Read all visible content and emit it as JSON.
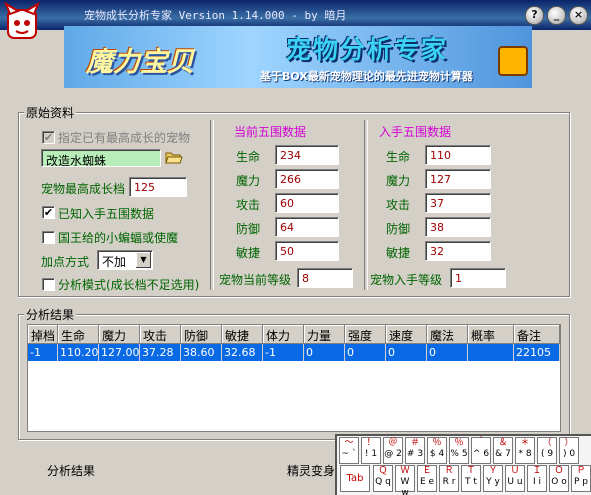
{
  "window": {
    "title": "宠物成长分析专家 Version 1.14.000 - by 暗月",
    "buttons": {
      "help": "?",
      "minimize": "_",
      "close": "×"
    }
  },
  "banner": {
    "logo_text": "魔力宝贝",
    "headline": "宠物分析专家",
    "subtitle": "基于BOX最新宠物理论的最先进宠物计算器"
  },
  "original": {
    "group_label": "原始资料",
    "designated_checkbox": {
      "label": "指定已有最高成长的宠物",
      "checked": true,
      "disabled": true
    },
    "pet_name": "改造水蜘蛛",
    "max_growth_label": "宠物最高成长档",
    "max_growth_value": "125",
    "known_stats_checkbox": {
      "label": "已知入手五围数据",
      "checked": true
    },
    "king_checkbox": {
      "label": "国王给的小蝙蝠或使魔",
      "checked": false
    },
    "add_method_label": "加点方式",
    "add_method_value": "不加",
    "analysis_mode_checkbox": {
      "label": "分析模式(成长档不足选用)",
      "checked": false
    },
    "current": {
      "title": "当前五围数据",
      "stats": [
        {
          "label": "生命",
          "value": "234"
        },
        {
          "label": "魔力",
          "value": "266"
        },
        {
          "label": "攻击",
          "value": "60"
        },
        {
          "label": "防御",
          "value": "64"
        },
        {
          "label": "敏捷",
          "value": "50"
        }
      ],
      "level_label": "宠物当前等级",
      "level_value": "8"
    },
    "acquired": {
      "title": "入手五围数据",
      "stats": [
        {
          "label": "生命",
          "value": "110"
        },
        {
          "label": "魔力",
          "value": "127"
        },
        {
          "label": "攻击",
          "value": "37"
        },
        {
          "label": "防御",
          "value": "38"
        },
        {
          "label": "敏捷",
          "value": "32"
        }
      ],
      "level_label": "宠物入手等级",
      "level_value": "1"
    }
  },
  "results": {
    "group_label": "分析结果",
    "columns": [
      "掉档",
      "生命",
      "魔力",
      "攻击",
      "防御",
      "敏捷",
      "体力",
      "力量",
      "强度",
      "速度",
      "魔法",
      "概率",
      "备注"
    ],
    "rows": [
      [
        "-1",
        "110.20",
        "127.00",
        "37.28",
        "38.60",
        "32.68",
        "-1",
        "0",
        "0",
        "0",
        "0",
        "",
        "22105"
      ]
    ]
  },
  "bottom": {
    "analyze_button": "分析结果",
    "spirit_label": "精灵变身"
  },
  "keyboard": {
    "row1": [
      {
        "top": "~",
        "bottom": "`",
        "alt": "～"
      },
      {
        "top": "!",
        "bottom": "1",
        "alt": "！"
      },
      {
        "top": "@",
        "bottom": "2",
        "alt": "＠"
      },
      {
        "top": "#",
        "bottom": "3",
        "alt": "＃"
      },
      {
        "top": "$",
        "bottom": "4",
        "alt": "％"
      },
      {
        "top": "%",
        "bottom": "5",
        "alt": "％"
      },
      {
        "top": "^",
        "bottom": "6",
        "alt": "＾"
      },
      {
        "top": "&",
        "bottom": "7",
        "alt": "＆"
      },
      {
        "top": "*",
        "bottom": "8",
        "alt": "＊"
      },
      {
        "top": "(",
        "bottom": "9",
        "alt": "（"
      },
      {
        "top": ")",
        "bottom": "0",
        "alt": "）"
      }
    ],
    "tab_label": "Tab",
    "row2": [
      {
        "top": "Q",
        "bottom": "q",
        "alt": "Ｑ"
      },
      {
        "top": "W",
        "bottom": "w",
        "alt": "Ｗ"
      },
      {
        "top": "E",
        "bottom": "e",
        "alt": "Ｅ"
      },
      {
        "top": "R",
        "bottom": "r",
        "alt": "Ｒ"
      },
      {
        "top": "T",
        "bottom": "t",
        "alt": "Ｔ"
      },
      {
        "top": "Y",
        "bottom": "y",
        "alt": "Ｙ"
      },
      {
        "top": "U",
        "bottom": "u",
        "alt": "Ｕ"
      },
      {
        "top": "I",
        "bottom": "i",
        "alt": "Ｉ"
      },
      {
        "top": "O",
        "bottom": "o",
        "alt": "Ｏ"
      },
      {
        "top": "P",
        "bottom": "p",
        "alt": "Ｐ"
      }
    ]
  }
}
